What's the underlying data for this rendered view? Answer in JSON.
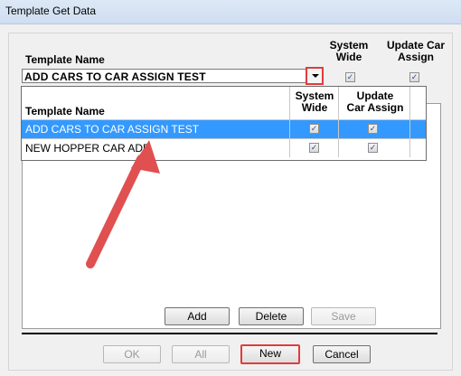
{
  "window": {
    "title": "Template Get Data"
  },
  "header": {
    "template_name": "Template Name",
    "system_wide": [
      "System",
      "Wide"
    ],
    "update_car_assign": [
      "Update Car",
      "Assign"
    ]
  },
  "combo": {
    "value": "ADD CARS TO CAR ASSIGN TEST",
    "system_wide_checked": true,
    "update_checked": true
  },
  "dropdown": {
    "columns": {
      "name": "Template Name",
      "system_wide": [
        "System",
        "Wide"
      ],
      "update_car_assign": [
        "Update",
        "Car Assign"
      ]
    },
    "rows": [
      {
        "name": "ADD CARS TO CAR ASSIGN TEST",
        "system_wide": true,
        "update": true,
        "selected": true
      },
      {
        "name": "NEW HOPPER CAR ADD",
        "system_wide": true,
        "update": true,
        "selected": false
      }
    ]
  },
  "grid_buttons": {
    "add": "Add",
    "delete": "Delete",
    "save": "Save"
  },
  "footer_buttons": {
    "ok": "OK",
    "all": "All",
    "new": "New",
    "cancel": "Cancel"
  },
  "colors": {
    "selection": "#3399ff",
    "highlight": "#e03c3c"
  }
}
